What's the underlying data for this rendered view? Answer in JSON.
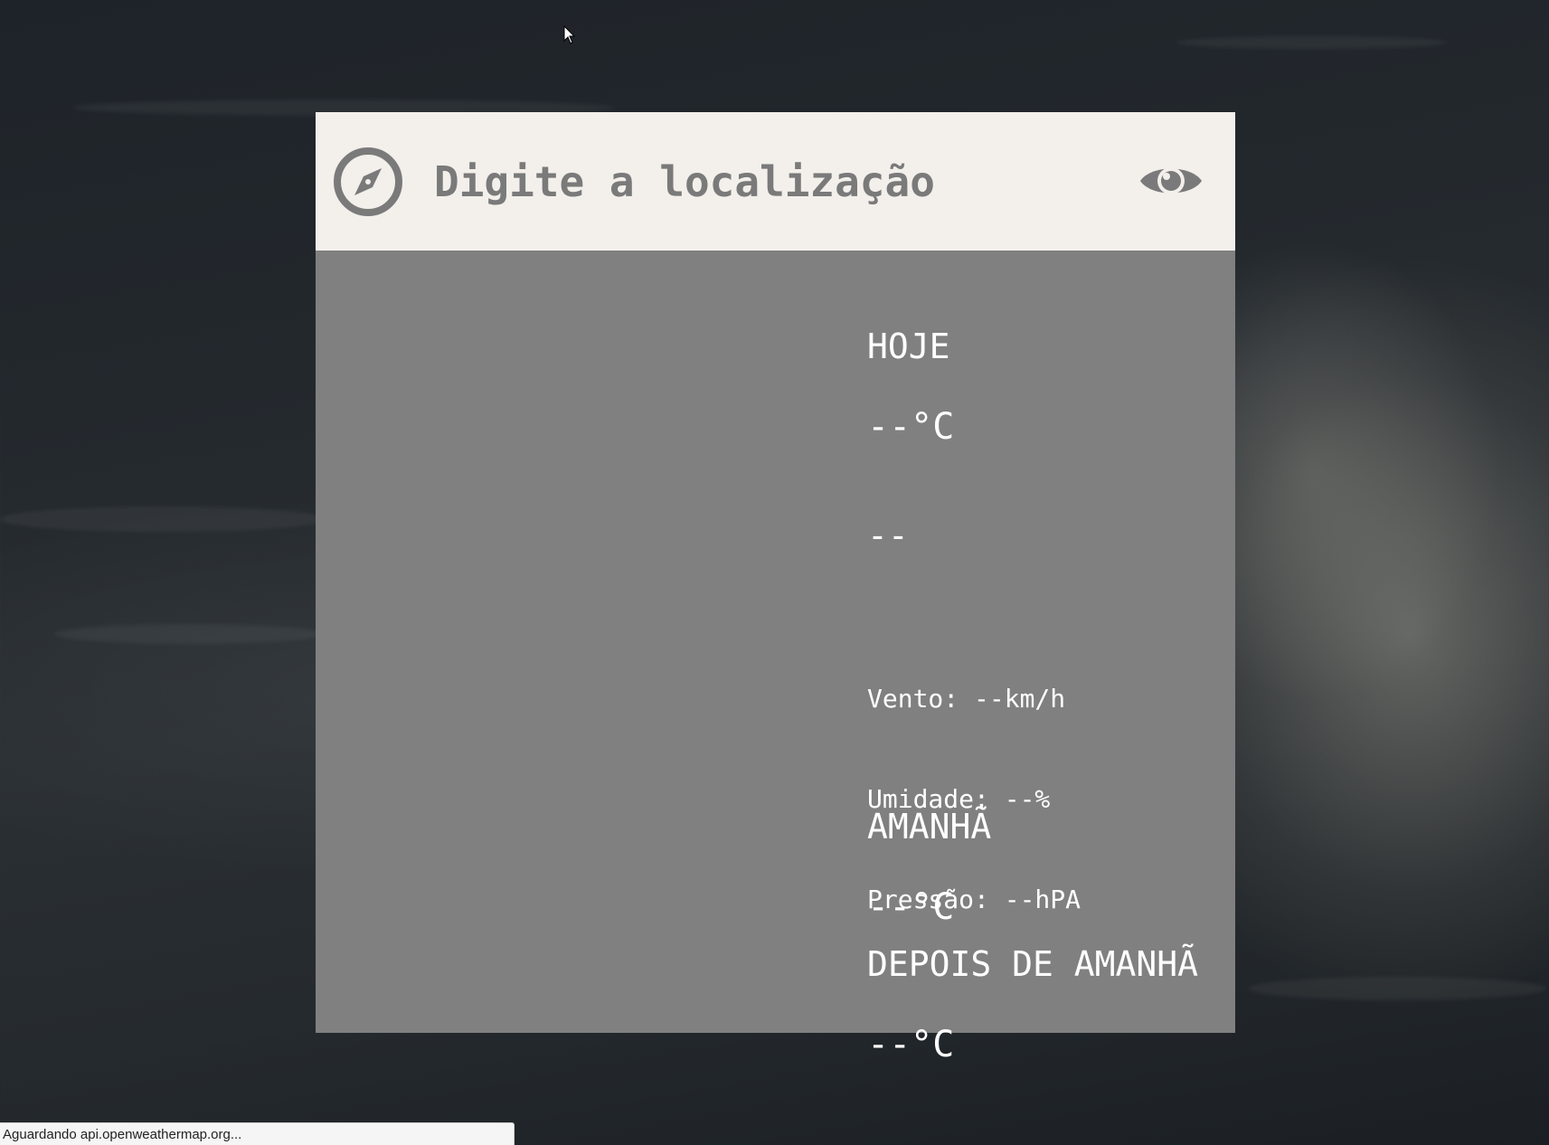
{
  "search": {
    "placeholder": "Digite a localização",
    "value": ""
  },
  "icons": {
    "left": "compass-icon",
    "right": "eye-icon"
  },
  "today": {
    "label": "HOJE",
    "temperature": "--°C",
    "description": "--",
    "wind": "Vento: --km/h",
    "humidity": "Umidade: --%",
    "pressure": "Pressão: --hPA"
  },
  "tomorrow": {
    "label": "AMANHÃ",
    "temperature": "--°C"
  },
  "after_tomorrow": {
    "label": "DEPOIS DE AMANHÃ",
    "temperature": "--°C"
  },
  "status_bar": {
    "text": "Aguardando api.openweathermap.org..."
  },
  "colors": {
    "header_bg": "#f3efeb",
    "panel_bg": "#808080",
    "icon": "#7a7a7a",
    "text": "#ffffff"
  }
}
